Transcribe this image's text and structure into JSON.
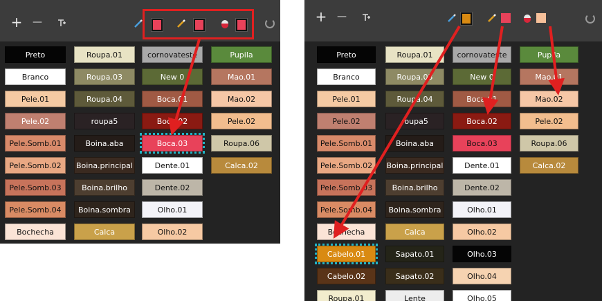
{
  "colors": {
    "panel_bg": "#232323",
    "toolbar_bg": "#3c3c3c",
    "arrow": "#e02020",
    "selection": "#21b4c6"
  },
  "left": {
    "toolbar": {
      "add_label": "+",
      "remove_label": "—",
      "tool_swatches": [
        "#e8425a",
        "#e8425a",
        "#e8425a"
      ]
    },
    "columns": [
      [
        {
          "label": "Preto",
          "bg": "#050505",
          "fg": "#ffffff"
        },
        {
          "label": "Branco",
          "bg": "#ffffff",
          "fg": "#111111"
        },
        {
          "label": "Pele.01",
          "bg": "#f5caa3",
          "fg": "#111111"
        },
        {
          "label": "Pele.02",
          "bg": "#c08070",
          "fg": "#ffffff"
        },
        {
          "label": "Pele.Somb.01",
          "bg": "#d88a6a",
          "fg": "#111111"
        },
        {
          "label": "Pele.Somb.02",
          "bg": "#e9a883",
          "fg": "#111111"
        },
        {
          "label": "Pele.Somb.03",
          "bg": "#c7735b",
          "fg": "#111111"
        },
        {
          "label": "Pele.Somb.04",
          "bg": "#d98b64",
          "fg": "#111111"
        },
        {
          "label": "Bochecha",
          "bg": "#fbe4d6",
          "fg": "#111111"
        }
      ],
      [
        {
          "label": "Roupa.01",
          "bg": "#e8e3c4",
          "fg": "#111111"
        },
        {
          "label": "Roupa.03",
          "bg": "#8e8a64",
          "fg": "#ffffff"
        },
        {
          "label": "Roupa.04",
          "bg": "#5e5a3a",
          "fg": "#ffffff"
        },
        {
          "label": "roupa5",
          "bg": "#2a2224",
          "fg": "#ffffff"
        },
        {
          "label": "Boina.aba",
          "bg": "#241c18",
          "fg": "#ffffff"
        },
        {
          "label": "Boina.principal",
          "bg": "#3a2a20",
          "fg": "#ffffff"
        },
        {
          "label": "Boina.brilho",
          "bg": "#4d3e30",
          "fg": "#ffffff"
        },
        {
          "label": "Boina.sombra",
          "bg": "#2e241c",
          "fg": "#ffffff"
        },
        {
          "label": "Calca",
          "bg": "#c9a14a",
          "fg": "#ffffff"
        }
      ],
      [
        {
          "label": "cornovateste",
          "bg": "#a9a9a9",
          "fg": "#111111"
        },
        {
          "label": "New 0",
          "bg": "#5c6a36",
          "fg": "#ffffff"
        },
        {
          "label": "Boca.01",
          "bg": "#a05a44",
          "fg": "#ffffff"
        },
        {
          "label": "Boca.02",
          "bg": "#8a1a12",
          "fg": "#ffffff"
        },
        {
          "label": "Boca.03",
          "bg": "#e8425a",
          "fg": "#ffffff",
          "selected": true
        },
        {
          "label": "Dente.01",
          "bg": "#ffffff",
          "fg": "#111111"
        },
        {
          "label": "Dente.02",
          "bg": "#bdb6a8",
          "fg": "#111111"
        },
        {
          "label": "Olho.01",
          "bg": "#f3f3f8",
          "fg": "#111111"
        },
        {
          "label": "Olho.02",
          "bg": "#f6c9a3",
          "fg": "#111111"
        }
      ],
      [
        {
          "label": "Pupila",
          "bg": "#5a8a3c",
          "fg": "#ffffff"
        },
        {
          "label": "Mao.01",
          "bg": "#b57660",
          "fg": "#ffffff"
        },
        {
          "label": "Mao.02",
          "bg": "#f6c7a6",
          "fg": "#111111"
        },
        {
          "label": "Pele.02",
          "bg": "#f2bd8e",
          "fg": "#111111"
        },
        {
          "label": "Roupa.06",
          "bg": "#cfc7a8",
          "fg": "#111111"
        },
        {
          "label": "Calca.02",
          "bg": "#b88a3c",
          "fg": "#ffffff"
        }
      ]
    ]
  },
  "right": {
    "toolbar": {
      "add_label": "+",
      "remove_label": "—",
      "tool_swatches": [
        "#d98a12",
        "#e8425a",
        "#f6c09a"
      ]
    },
    "columns": [
      [
        {
          "label": "Preto",
          "bg": "#050505",
          "fg": "#ffffff"
        },
        {
          "label": "Branco",
          "bg": "#ffffff",
          "fg": "#111111"
        },
        {
          "label": "Pele.01",
          "bg": "#f5caa3",
          "fg": "#111111"
        },
        {
          "label": "Pele.02",
          "bg": "#c08070",
          "fg": "#111111"
        },
        {
          "label": "Pele.Somb.01",
          "bg": "#d88a6a",
          "fg": "#111111"
        },
        {
          "label": "Pele.Somb.02",
          "bg": "#e9a883",
          "fg": "#111111"
        },
        {
          "label": "Pele.Somb.03",
          "bg": "#c7735b",
          "fg": "#111111"
        },
        {
          "label": "Pele.Somb.04",
          "bg": "#d98b64",
          "fg": "#111111"
        },
        {
          "label": "Bochecha",
          "bg": "#fbe4d6",
          "fg": "#111111"
        },
        {
          "label": "Cabelo.01",
          "bg": "#d98a12",
          "fg": "#ffffff",
          "selected": true
        },
        {
          "label": "Cabelo.02",
          "bg": "#5a3418",
          "fg": "#ffffff"
        },
        {
          "label": "Roupa.01",
          "bg": "#f2eccd",
          "fg": "#111111"
        }
      ],
      [
        {
          "label": "Roupa.01",
          "bg": "#e8e3c4",
          "fg": "#111111"
        },
        {
          "label": "Roupa.03",
          "bg": "#8e8a64",
          "fg": "#ffffff"
        },
        {
          "label": "Roupa.04",
          "bg": "#5e5a3a",
          "fg": "#ffffff"
        },
        {
          "label": "roupa5",
          "bg": "#2a2224",
          "fg": "#ffffff"
        },
        {
          "label": "Boina.aba",
          "bg": "#241c18",
          "fg": "#ffffff"
        },
        {
          "label": "Boina.principal",
          "bg": "#3a2a20",
          "fg": "#ffffff"
        },
        {
          "label": "Boina.brilho",
          "bg": "#4d3e30",
          "fg": "#ffffff"
        },
        {
          "label": "Boina.sombra",
          "bg": "#2e241c",
          "fg": "#ffffff"
        },
        {
          "label": "Calca",
          "bg": "#c9a14a",
          "fg": "#ffffff"
        },
        {
          "label": "Sapato.01",
          "bg": "#242418",
          "fg": "#ffffff"
        },
        {
          "label": "Sapato.02",
          "bg": "#3a2e1a",
          "fg": "#ffffff"
        },
        {
          "label": "Lente",
          "bg": "#ededed",
          "fg": "#111111"
        }
      ],
      [
        {
          "label": "cornovateste",
          "bg": "#a9a9a9",
          "fg": "#111111"
        },
        {
          "label": "New 0",
          "bg": "#5c6a36",
          "fg": "#ffffff"
        },
        {
          "label": "Boca.01",
          "bg": "#a05a44",
          "fg": "#ffffff"
        },
        {
          "label": "Boca.02",
          "bg": "#8a1a12",
          "fg": "#ffffff"
        },
        {
          "label": "Boca.03",
          "bg": "#e8425a",
          "fg": "#111111"
        },
        {
          "label": "Dente.01",
          "bg": "#ffffff",
          "fg": "#111111"
        },
        {
          "label": "Dente.02",
          "bg": "#bdb6a8",
          "fg": "#111111"
        },
        {
          "label": "Olho.01",
          "bg": "#f3f3f8",
          "fg": "#111111"
        },
        {
          "label": "Olho.02",
          "bg": "#f6c9a3",
          "fg": "#111111"
        },
        {
          "label": "Olho.03",
          "bg": "#050505",
          "fg": "#ffffff"
        },
        {
          "label": "Olho.04",
          "bg": "#f6d3b1",
          "fg": "#111111"
        },
        {
          "label": "Olho.05",
          "bg": "#ffffff",
          "fg": "#111111"
        }
      ],
      [
        {
          "label": "Pupila",
          "bg": "#5a8a3c",
          "fg": "#ffffff"
        },
        {
          "label": "Mao.01",
          "bg": "#b57660",
          "fg": "#ffffff"
        },
        {
          "label": "Mao.02",
          "bg": "#f6c7a6",
          "fg": "#111111"
        },
        {
          "label": "Pele.02",
          "bg": "#f2bd8e",
          "fg": "#111111"
        },
        {
          "label": "Roupa.06",
          "bg": "#cfc7a8",
          "fg": "#111111"
        },
        {
          "label": "Calca.02",
          "bg": "#b88a3c",
          "fg": "#ffffff"
        }
      ]
    ]
  }
}
